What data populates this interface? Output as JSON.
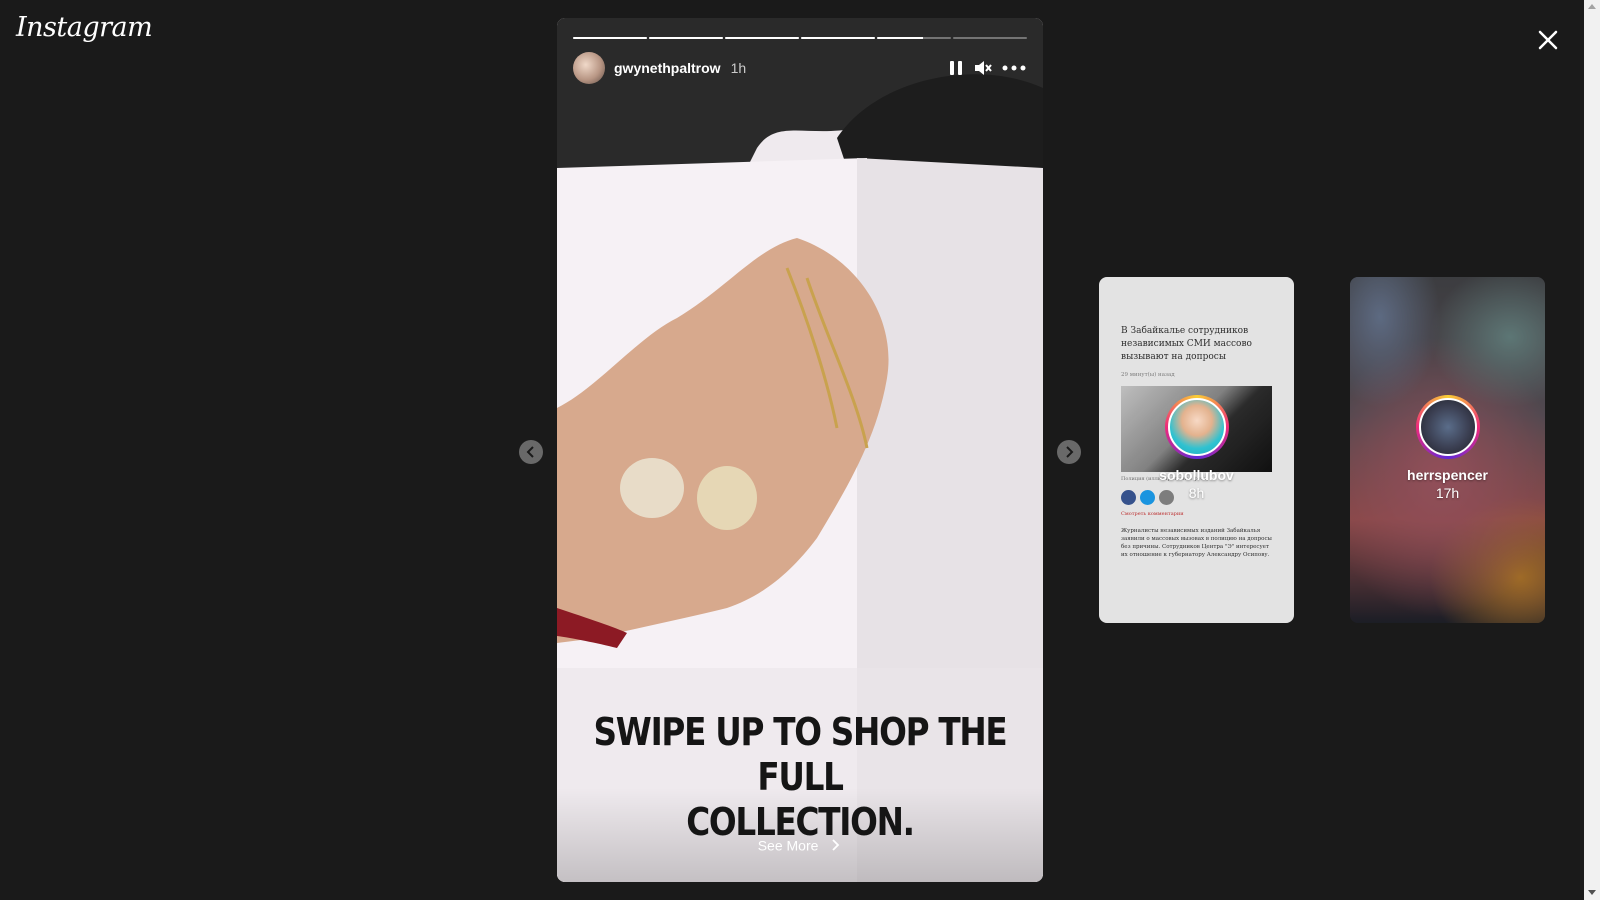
{
  "app": {
    "logo_text": "Instagram",
    "close_icon": "close-icon"
  },
  "story": {
    "username": "gwynethpaltrow",
    "time_ago": "1h",
    "progress": [
      1,
      1,
      1,
      1,
      0.62,
      0
    ],
    "overlay_text_line1": "SWIPE UP TO SHOP THE FULL",
    "overlay_text_line2": "COLLECTION.",
    "see_more_label": "See More",
    "controls": [
      "pause-icon",
      "mute-icon",
      "more-icon"
    ]
  },
  "navigation": {
    "prev_icon": "chevron-left-icon",
    "next_icon": "chevron-right-icon"
  },
  "previews": [
    {
      "username": "sobollubov",
      "time_ago": "8h",
      "article": {
        "title": "В Забайкалье сотрудников независимых СМИ массово вызывают на допросы",
        "date": "29 минут(ы) назад",
        "caption": "Полиция (иллюстративное фото)",
        "comments": "Смотреть комментарии",
        "body": "Журналисты независимых изданий Забайкалья заявили о массовых вызовах в полицию на допросы без причины. Сотрудников Центра \"Э\" интересует их отношение к губернатору Александру Осипову."
      }
    },
    {
      "username": "herrspencer",
      "time_ago": "17h"
    }
  ],
  "colors": {
    "background": "#1a1a1a",
    "facebook": "#3b5998",
    "twitter": "#1da1f2",
    "share": "#888888"
  }
}
